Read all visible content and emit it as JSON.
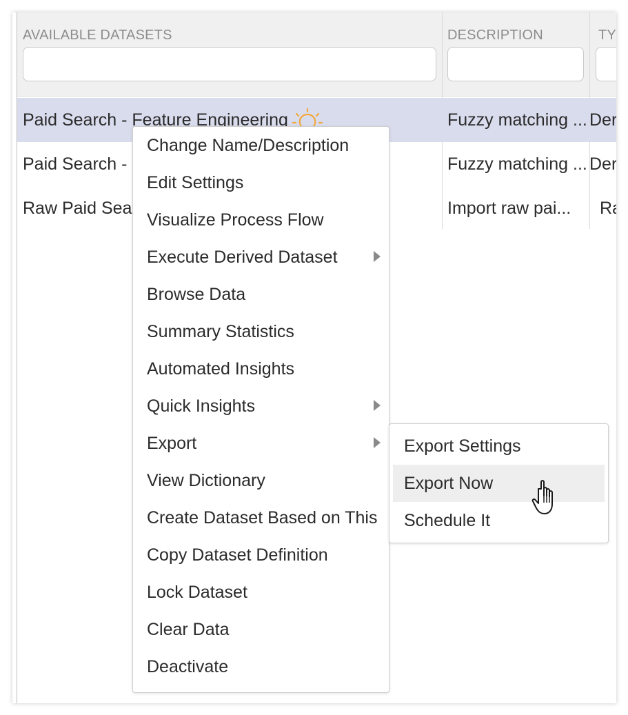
{
  "grid": {
    "columns": [
      {
        "label": "AVAILABLE DATASETS",
        "filter_value": ""
      },
      {
        "label": "DESCRIPTION",
        "filter_value": ""
      },
      {
        "label": "TYI",
        "filter_value": ""
      }
    ],
    "rows": [
      {
        "name": "Paid Search - Feature Engineering",
        "description": "Fuzzy matching ...",
        "type": "Der",
        "selected": true
      },
      {
        "name": "Paid Search - F",
        "description": "Fuzzy matching ...",
        "type": "Der",
        "selected": false
      },
      {
        "name": "Raw Paid Sear",
        "description": "Import raw pai...",
        "type": "Ra",
        "selected": false
      }
    ]
  },
  "context_menu": {
    "items": [
      {
        "label": "Change Name/Description",
        "submenu": false
      },
      {
        "label": "Edit Settings",
        "submenu": false
      },
      {
        "label": "Visualize Process Flow",
        "submenu": false
      },
      {
        "label": "Execute Derived Dataset",
        "submenu": true
      },
      {
        "label": "Browse Data",
        "submenu": false
      },
      {
        "label": "Summary Statistics",
        "submenu": false
      },
      {
        "label": "Automated Insights",
        "submenu": false
      },
      {
        "label": "Quick Insights",
        "submenu": true
      },
      {
        "label": "Export",
        "submenu": true
      },
      {
        "label": "View Dictionary",
        "submenu": false
      },
      {
        "label": "Create Dataset Based on This",
        "submenu": false
      },
      {
        "label": "Copy Dataset Definition",
        "submenu": false
      },
      {
        "label": "Lock Dataset",
        "submenu": false
      },
      {
        "label": "Clear Data",
        "submenu": false
      },
      {
        "label": "Deactivate",
        "submenu": false
      }
    ]
  },
  "export_submenu": {
    "items": [
      {
        "label": "Export Settings",
        "hovered": false
      },
      {
        "label": "Export Now",
        "hovered": true
      },
      {
        "label": "Schedule It",
        "hovered": false
      }
    ]
  },
  "icons": {
    "row_badge": "lightbulb-icon",
    "submenu_indicator": "caret-right-icon",
    "cursor": "hand-pointer-icon"
  },
  "colors": {
    "selected_row": "#d9dced",
    "header_bg": "#f0f0f0",
    "menu_hover": "#eeeeee",
    "bulb": "#f2a93b"
  }
}
